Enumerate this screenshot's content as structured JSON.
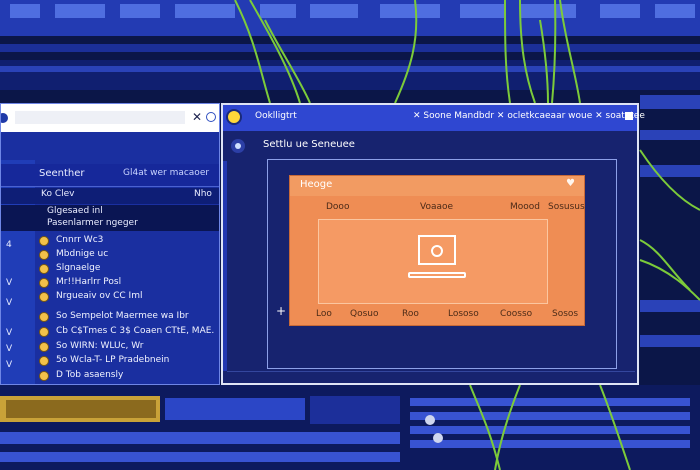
{
  "left_window": {
    "close_symbol": "✕",
    "header": {
      "title": "Seenther",
      "subtitle": "Gl4at wer macaoer"
    },
    "subheader": {
      "left": "Ko Clev",
      "right": "Nho"
    },
    "detail": {
      "line1": "Glgesaed inl",
      "line2": "Pasenlarmer ngeger"
    },
    "side_labels": [
      "V",
      "o",
      "o",
      "4",
      "V",
      "V",
      "V",
      "V",
      "V"
    ],
    "items": [
      "Cnnrr Wc3",
      "Mbdnige uc",
      "Slgnaelge",
      "Mr!!Harlrr Posl",
      "Nrgueaiv ov CC Iml",
      "So Sempelot Maermee wa Ibr",
      "Cb C$Tmes C 3$ Coaen CTtE, MAE.",
      "So WIRN: WLUc, Wr",
      "5o Wcla-T- LP Pradebnein",
      "D Tob asaensly"
    ]
  },
  "main_window": {
    "tab_title": "Ooklligtrt",
    "tab_rest": "✕ Soone Mandbdr ✕ ocletkcaeaar woue ✕ soatatee",
    "header_title": "Settlu ue Seneuee",
    "card": {
      "title": "Heoge",
      "nav": [
        "Dooo",
        "Voaaoe",
        "Moood",
        "Sosusus"
      ],
      "footer": [
        "Loo",
        "Qosuo",
        "Roo",
        "Lososo",
        "Coosso",
        "Sosos"
      ]
    }
  },
  "icons": {
    "app_logo": "lightbulb-icon",
    "monitor": "monitor-icon",
    "heart": "heart-icon"
  },
  "colors": {
    "accent_blue": "#2f47d1",
    "card_orange": "#ef8d54",
    "background": "#0b1648"
  }
}
